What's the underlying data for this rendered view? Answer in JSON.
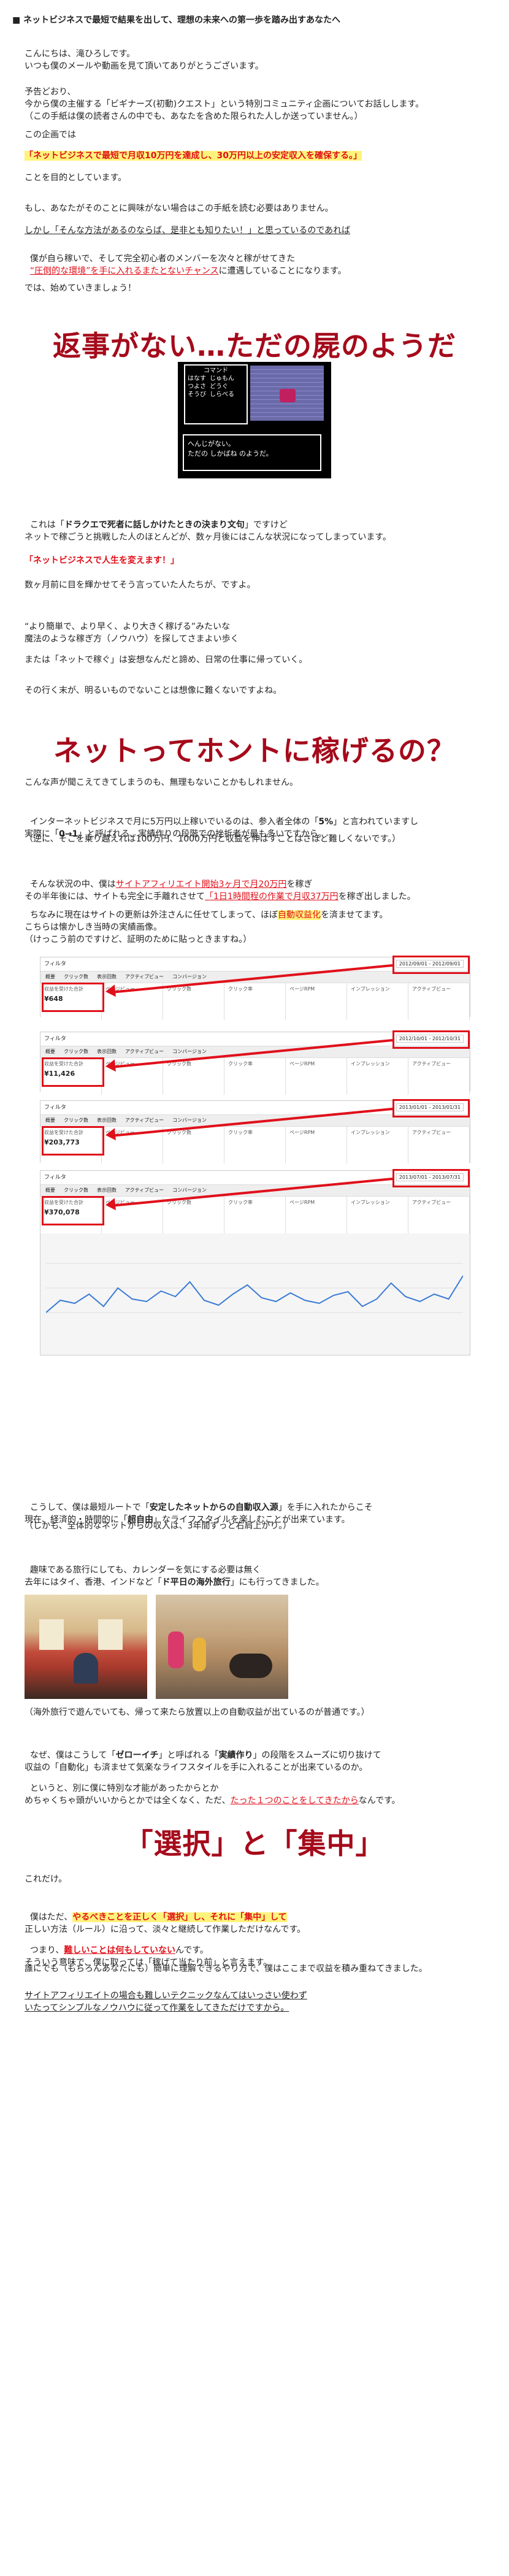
{
  "title": "■ ネットビジネスで最短で結果を出して、理想の未来への第一歩を踏み出すあなたへ",
  "intro": {
    "p1": "こんにちは、滝ひろしです。\nいつも僕のメールや動画を見て頂いてありがとうございます。",
    "p2": "予告どおり、\n今から僕の主催する「ビギナーズ(初動)クエスト」という特別コミュニティ企画についてお話しします。\n（この手紙は僕の読者さんの中でも、あなたを含めた限られた人しか送っていません。）",
    "p3": "この企画では",
    "highlight": "「ネットビジネスで最短で月収10万円を達成し、30万円以上の安定収入を確保する。」",
    "p4": "ことを目的としています。",
    "p5": "もし、あなたがそのことに興味がない場合はこの手紙を読む必要はありません。",
    "p6": "しかし「そんな方法があるのならば、是非とも知りたい！」と思っているのであれば",
    "p7a": "僕が自ら稼いで、そして完全初心者のメンバーを次々と稼がせてきた",
    "p7b": "“圧倒的な環境”を手に入れるまたとないチャンス",
    "p7c": "に遭遇していることになります。",
    "p8": "では、始めていきましょう！"
  },
  "section1": {
    "heading": "返事がない…ただの屍のようだ",
    "game": {
      "menu": [
        "コマンド",
        "はなす",
        "じゅもん",
        "つよさ",
        "どうぐ",
        "そうび",
        "しらべる"
      ],
      "message": "へんじがない。\nただの しかばね のようだ。"
    },
    "p1a": "これは「",
    "p1b": "ドラクエで死者に話しかけたときの決まり文句",
    "p1c": "」ですけど\nネットで稼ごうと挑戦した人のほとんどが、数ヶ月後にはこんな状況になってしまっています。",
    "quote": "「ネットビジネスで人生を変えます！」",
    "p2": "数ヶ月前に目を輝かせてそう言っていた人たちが、ですよ。",
    "p3": "“より簡単で、より早く、より大きく稼げる”みたいな\n魔法のような稼ぎ方（ノウハウ）を探してさまよい歩く",
    "p4": "または「ネットで稼ぐ」は妄想なんだと諦め、日常の仕事に帰っていく。",
    "p5": "その行く末が、明るいものでないことは想像に難くないですよね。"
  },
  "section2": {
    "heading": "ネットってホントに稼げるの？",
    "p1": "こんな声が聞こえてきてしまうのも、無理もないことかもしれません。",
    "p2a": "インターネットビジネスで月に5万円以上稼いでいるのは、参入者全体の「",
    "p2b": "5%",
    "p2c": "」と言われていますし\n実際に「",
    "p2d": "0→1",
    "p2e": "」と呼ばれる、実績作りの段階での挫折者が最も多いですから。",
    "p3": "（逆に、そこを乗り越えれば100万円、1000万円と収益を伸ばすことはさほど難しくないです。）",
    "p4a": "そんな状況の中、僕は",
    "p4b": "サイトアフィリエイト開始3ヶ月で月20万円",
    "p4c": "を稼ぎ\nその半年後には、サイトも完全に手離れさせて",
    "p4d": "「1日1時間程の作業で月収37万円",
    "p4e": "を稼ぎ出しました。",
    "p5a": "ちなみに現在はサイトの更新は外注さんに任せてしまって、ほぼ",
    "p5b": "自動収益化",
    "p5c": "を済ませてます。",
    "p6": "こちらは懐かしき当時の実績画像。\n（けっこう前のですけど、証明のために貼っときますね。）",
    "screenshots": [
      {
        "label": "収益を受けた合計",
        "value": "¥648",
        "date": "2012/09/01 - 2012/09/01"
      },
      {
        "label": "収益を受けた合計",
        "value": "¥11,426",
        "date": "2012/10/01 - 2012/10/31"
      },
      {
        "label": "収益を受けた合計",
        "value": "¥203,773",
        "date": "2013/01/01 - 2013/01/31"
      },
      {
        "label": "収益を受けた合計",
        "value": "¥370,078",
        "date": "2013/07/01 - 2013/07/31"
      }
    ],
    "ss_columns": [
      "ページビュー",
      "クリック数",
      "クリック率",
      "ページRPM",
      "インプレッション",
      "アクティブビュー"
    ],
    "ss_filter": "フィルタ",
    "ss_tabs": [
      "概要",
      "クリック数",
      "表示回数",
      "アクティブビュー",
      "コンバージョン"
    ],
    "p7a": "こうして、僕は最短ルートで「",
    "p7b": "安定したネットからの自動収入源",
    "p7c": "」を手に入れたからこそ\n現在、経済的・時間的に「",
    "p7d": "超自由",
    "p7e": "」なライフスタイルを楽しむことが出来ています。",
    "p8": "（しかも、全体的なネットからの収入は、3年間ずっと右肩上がり。）",
    "p9a": "趣味である旅行にしても、カレンダーを気にする必要は無く\n去年にはタイ、香港、インドなど「",
    "p9b": "ド平日の海外旅行",
    "p9c": "」にも行ってきました。",
    "caption": "（海外旅行で遊んでいても、帰って来たら放置以上の自動収益が出ているのが普通です。）",
    "p10a": "なぜ、僕はこうして「",
    "p10b": "ゼローイチ",
    "p10c": "」と呼ばれる「",
    "p10d": "実績作り",
    "p10e": "」の段階をスムーズに切り抜けて\n収益の「自動化」も済ませて気楽なライフスタイルを手に入れることが出来ているのか。",
    "p11a": "というと、別に僕に特別な才能があったからとか\nめちゃくちゃ頭がいいからとかでは全くなく、ただ、",
    "p11b": "たった１つのことをしてきたから",
    "p11c": "なんです。"
  },
  "section3": {
    "heading": "「選択」と「集中」",
    "p1": "これだけ。",
    "p2a": "僕はただ、",
    "p2b": "やるべきことを正しく「選択」し、それに「集中」して",
    "p2c": "\n正しい方法（ルール）に沿って、淡々と継続して作業しただけなんです。",
    "p3a": "つまり、",
    "p3b": "難しいことは何もしていない",
    "p3c": "んです。\nそういう意味で、僕に取っては「稼げて当たり前」と言えます。",
    "p4": "誰にでも（もちろんあなたにも）簡単に理解できるやり方で、僕はここまで収益を積み重ねてきました。",
    "p5": "サイトアフィリエイトの場合も難しいテクニックなんてはいっさい使わず\nいたってシンプルなノウハウに従って作業をしてきただけですから。"
  }
}
